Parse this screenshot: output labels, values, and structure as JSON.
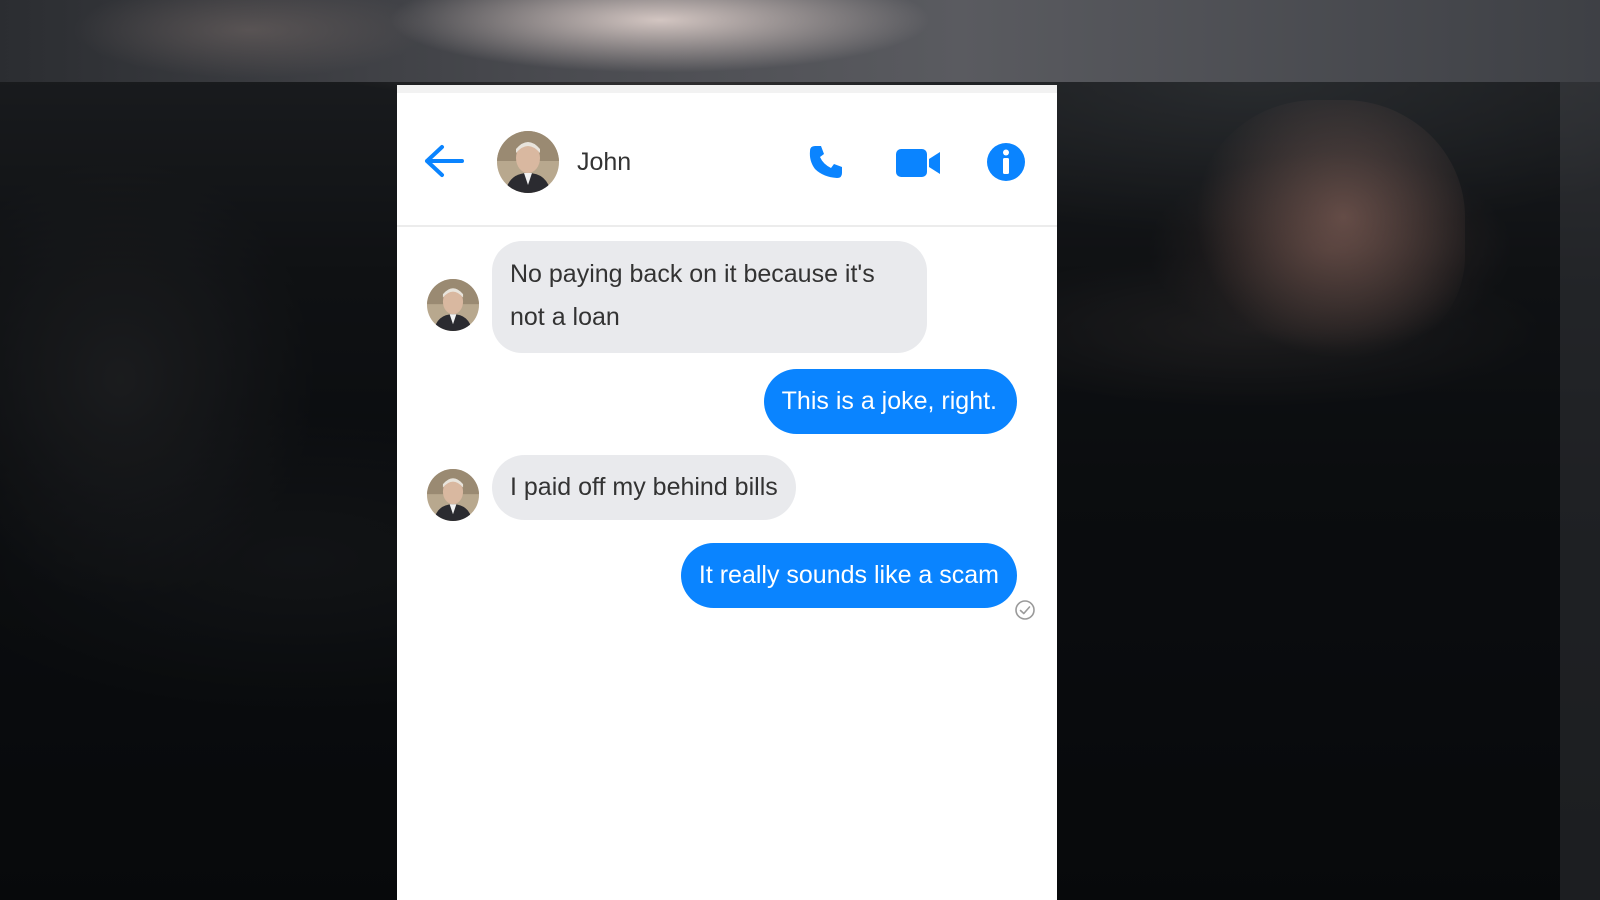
{
  "header": {
    "contact_name": "John"
  },
  "colors": {
    "accent": "#0a84ff",
    "incoming_bubble": "#e9eaed",
    "outgoing_bubble": "#0a84ff"
  },
  "icons": {
    "back": "back-arrow-icon",
    "call": "phone-icon",
    "video": "video-camera-icon",
    "info": "info-icon",
    "seen": "check-circle-icon"
  },
  "messages": [
    {
      "direction": "incoming",
      "text": "No paying back on it because it's not a loan"
    },
    {
      "direction": "outgoing",
      "text": "This is a joke, right."
    },
    {
      "direction": "incoming",
      "text": "I paid off my behind bills"
    },
    {
      "direction": "outgoing",
      "text": "It really sounds like a scam"
    }
  ]
}
